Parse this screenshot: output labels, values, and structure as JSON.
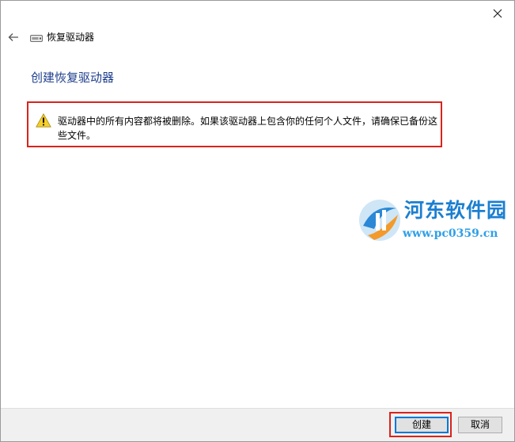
{
  "window": {
    "title": "恢复驱动器",
    "heading": "创建恢复驱动器"
  },
  "warning": {
    "text": "驱动器中的所有内容都将被删除。如果该驱动器上包含你的任何个人文件，请确保已备份这些文件。"
  },
  "watermark": {
    "name": "河东软件园",
    "url": "www.pc0359.cn"
  },
  "buttons": {
    "create": "创建",
    "cancel": "取消"
  },
  "icons": {
    "close": "close-icon",
    "back": "back-arrow-icon",
    "drive": "drive-icon",
    "warning": "warning-icon"
  },
  "colors": {
    "heading": "#1e3e8c",
    "highlight": "#d9231d",
    "watermark_text": "#1b7fd1",
    "watermark_url": "#2fa0e8"
  }
}
